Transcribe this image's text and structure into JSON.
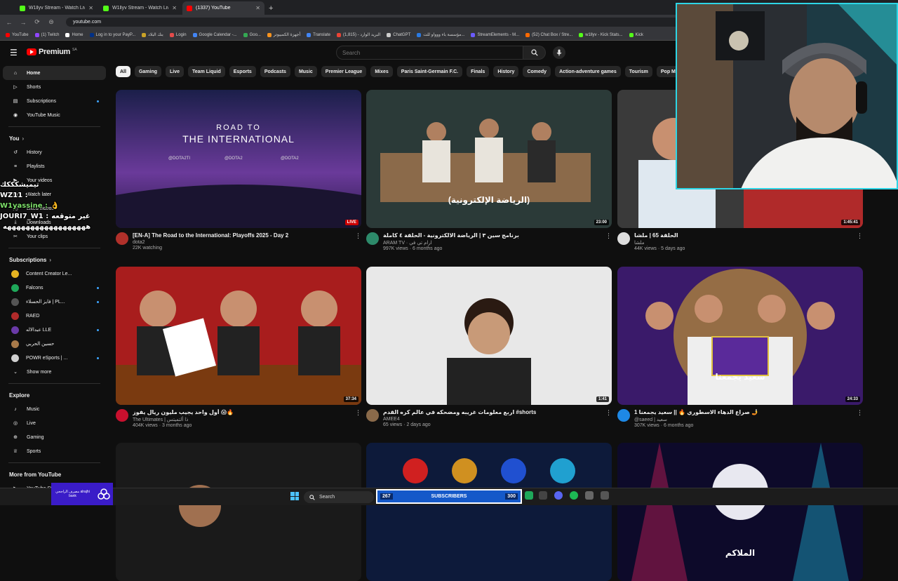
{
  "browser": {
    "tabs": [
      {
        "title": "W1llyv Stream - Watch Live on",
        "color": "#53fc18",
        "active": false
      },
      {
        "title": "W1llyv Stream - Watch Live on",
        "color": "#53fc18",
        "active": false
      },
      {
        "title": "(1337) YouTube",
        "color": "#ff0000",
        "active": true
      }
    ],
    "new_tab": "+",
    "url": "youtube.com",
    "bookmarks": [
      {
        "label": "YouTube",
        "color": "#ff0000"
      },
      {
        "label": "(1) Twitch",
        "color": "#9146ff"
      },
      {
        "label": "Home",
        "color": "#ffffff"
      },
      {
        "label": "Log in to your PayP...",
        "color": "#003087"
      },
      {
        "label": "بنك البلاد",
        "color": "#c9a227"
      },
      {
        "label": "Login",
        "color": "#e34b4b"
      },
      {
        "label": "Google Calendar -...",
        "color": "#4285f4"
      },
      {
        "label": "Goo...",
        "color": "#34a853"
      },
      {
        "label": "أجهزة الكمبيوتر",
        "color": "#f7931e"
      },
      {
        "label": "Translate",
        "color": "#4285f4"
      },
      {
        "label": "البريد الوارد - (1,815)",
        "color": "#ea4335"
      },
      {
        "label": "ChatGPT",
        "color": "#cccccc"
      },
      {
        "label": "مؤسسة باء ووواو للت...",
        "color": "#2a7ae2"
      },
      {
        "label": "StreamElements - M...",
        "color": "#6b5bff"
      },
      {
        "label": "(52) Chat Box / Stre...",
        "color": "#ff6a00"
      },
      {
        "label": "w1llyv - Kick Stats...",
        "color": "#53fc18"
      },
      {
        "label": "Kick",
        "color": "#53fc18"
      }
    ]
  },
  "header": {
    "logo_text": "Premium",
    "region": "SA",
    "search_placeholder": "Search"
  },
  "sidebar": {
    "main": [
      {
        "label": "Home",
        "icon": "home-icon",
        "active": true
      },
      {
        "label": "Shorts",
        "icon": "shorts-icon"
      },
      {
        "label": "Subscriptions",
        "icon": "subscriptions-icon",
        "dot": true
      },
      {
        "label": "YouTube Music",
        "icon": "music-icon"
      }
    ],
    "you_label": "You",
    "you": [
      {
        "label": "History",
        "icon": "history-icon"
      },
      {
        "label": "Playlists",
        "icon": "playlists-icon"
      },
      {
        "label": "Your videos",
        "icon": "your-videos-icon"
      },
      {
        "label": "Watch later",
        "icon": "watch-later-icon"
      },
      {
        "label": "Liked videos",
        "icon": "liked-icon"
      },
      {
        "label": "Downloads",
        "icon": "download-icon"
      },
      {
        "label": "Your clips",
        "icon": "clips-icon"
      }
    ],
    "subs_label": "Subscriptions",
    "subs": [
      {
        "label": "Content Creator Le...",
        "color": "#e6b422"
      },
      {
        "label": "Falcons",
        "color": "#1fa85a",
        "dot": true
      },
      {
        "label": "فايز الحسلاء | PL...",
        "color": "#555555",
        "dot": true
      },
      {
        "label": "RAED",
        "color": "#b02a2a"
      },
      {
        "label": "عبدالاله LLE",
        "color": "#6a3aa8",
        "dot": true
      },
      {
        "label": "حسين الحربي",
        "color": "#a87a4a"
      },
      {
        "label": "POWR eSports | ...",
        "color": "#d0d0d0",
        "dot": true
      }
    ],
    "show_more": "Show more",
    "explore_label": "Explore",
    "explore": [
      {
        "label": "Music",
        "icon": "music-note-icon"
      },
      {
        "label": "Live",
        "icon": "live-icon"
      },
      {
        "label": "Gaming",
        "icon": "gaming-icon"
      },
      {
        "label": "Sports",
        "icon": "trophy-icon"
      }
    ],
    "more_label": "More from YouTube",
    "studio": "YouTube Studio"
  },
  "chips": [
    "All",
    "Gaming",
    "Live",
    "Team Liquid",
    "Esports",
    "Podcasts",
    "Music",
    "Premier League",
    "Mixes",
    "Paris Saint-Germain F.C.",
    "Finals",
    "History",
    "Comedy",
    "Action-adventure games",
    "Tourism",
    "Pop Music"
  ],
  "videos": [
    {
      "title": "[EN-A] The Road to the International: Playoffs 2025 - Day 2",
      "channel": "dota2",
      "stats": "22K watching",
      "badge": "LIVE",
      "live": true,
      "avatar": "#b0302a",
      "thumb_title": "ROAD TO",
      "thumb_sub": "THE INTERNATIONAL",
      "thumb_handles": [
        "@DOTA2TI",
        "@DOTA2",
        "@DOTA2"
      ]
    },
    {
      "title": "برنامج سين ٣ | الرياضة الالكترونية - الحلقة ٤ كاملة",
      "channel": "ARAM TV · ارام تي في",
      "stats": "997K views · 6 months ago",
      "badge": "23:00",
      "avatar": "#2d8a6a",
      "thumb_text": "(الرياضة الإلكترونية)"
    },
    {
      "title": "الحلقة 65 | ملشا",
      "channel": "ملشا",
      "stats": "44K views · 5 days ago",
      "badge": "1:45:41",
      "avatar": "#ddd"
    },
    {
      "title": "أول واحد يجيب مليون ريال يفوز 😱🔥",
      "channel": "The Ultimates | ذا ألتميتس",
      "stats": "404K views · 3 months ago",
      "badge": "37:34",
      "avatar": "#c8102e"
    },
    {
      "title": "اربع معلومات غريبه ومضحكه في عالم كره القدم #shorts",
      "channel": "AMEE4",
      "stats": "65 views · 2 days ago",
      "badge": "1:41",
      "avatar": "#8a6a4a"
    },
    {
      "title": "صراع الدهاء الاسطوري 🔥 || سعيد يجمعنا 1 🤳",
      "channel": "@saeed | سعيد",
      "stats": "307K views · 6 months ago",
      "badge": "24:33",
      "avatar": "#1e88e5",
      "thumb_text": "سعيد يجمعنا"
    },
    {
      "title": "",
      "channel": "",
      "stats": "",
      "badge": "",
      "avatar": "#333"
    },
    {
      "title": "",
      "channel": "",
      "stats": "",
      "badge": "",
      "avatar": "#333"
    },
    {
      "title": "",
      "channel": "",
      "stats": "",
      "badge": "",
      "avatar": "#333",
      "thumb_text": "الملاكم"
    }
  ],
  "overlay": {
    "chat": [
      {
        "user": "تيميشكككك",
        "msg": "",
        "user_color": "#ffffff"
      },
      {
        "user": "WZ11 :",
        "msg": "",
        "user_color": "#ffffff"
      },
      {
        "user": "W1yassine :",
        "msg": "👌",
        "user_color": "#7ee06a"
      },
      {
        "user": "JOURI7_W1 :",
        "msg": "غير متوقعه",
        "user_color": "#ffffff"
      },
      {
        "user": "",
        "msg": "ههههههههههههههههههه",
        "user_color": "#ffffff"
      }
    ],
    "subscribers": {
      "count": "267",
      "label": "SUBSCRIBERS",
      "goal": "300"
    },
    "bank_label": "مصرف الراجحي alrajhi bank"
  },
  "taskbar": {
    "search": "Search"
  }
}
